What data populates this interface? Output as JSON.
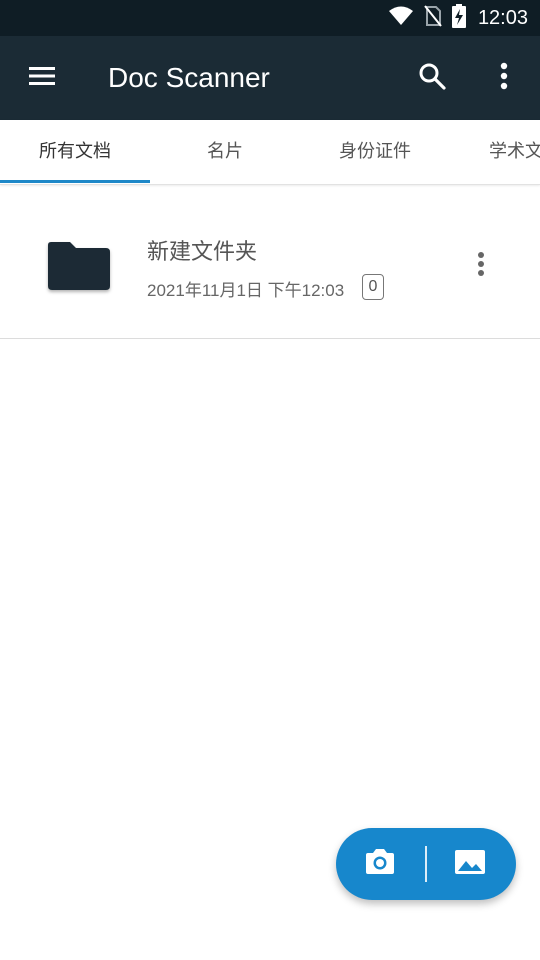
{
  "status_bar": {
    "time": "12:03",
    "icons": [
      "wifi-icon",
      "no-sim-icon",
      "battery-charging-icon"
    ]
  },
  "app_bar": {
    "title": "Doc Scanner",
    "icons": [
      "menu-icon",
      "search-icon",
      "more-vert-icon"
    ],
    "background_color": "#1b2b35"
  },
  "tabs": [
    {
      "label": "所有文档",
      "active": true
    },
    {
      "label": "名片",
      "active": false
    },
    {
      "label": "身份证件",
      "active": false
    },
    {
      "label": "学术文",
      "active": false
    }
  ],
  "accent_color": "#1e88c8",
  "folders": [
    {
      "name": "新建文件夹",
      "date": "2021年11月1日 下午12:03",
      "count": "0",
      "icon": "folder-icon"
    }
  ],
  "fab": {
    "color": "#1787cc",
    "icons": [
      "camera-icon",
      "gallery-icon"
    ]
  }
}
